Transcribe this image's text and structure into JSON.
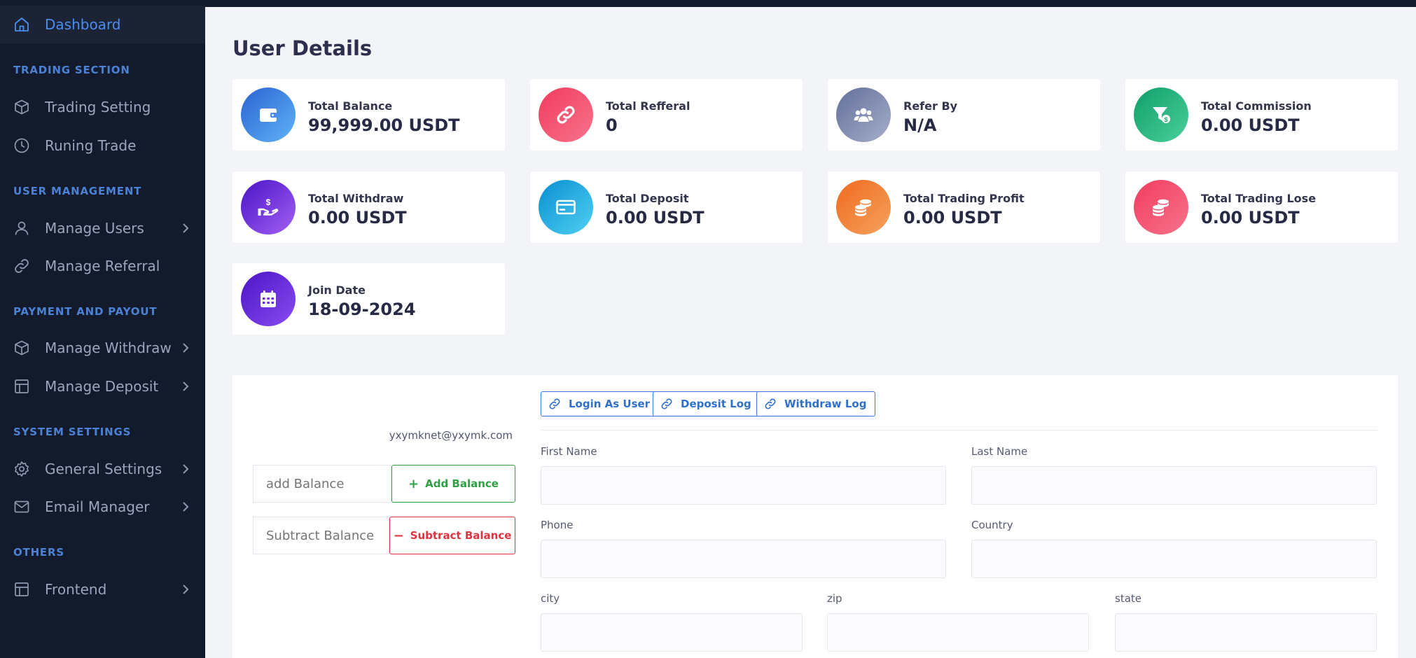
{
  "sidebar": {
    "active": "Dashboard",
    "sections": {
      "trading": "TRADING SECTION",
      "users": "USER MANAGEMENT",
      "payment": "PAYMENT AND PAYOUT",
      "system": "SYSTEM SETTINGS",
      "others": "OTHERS"
    },
    "items": {
      "dashboard": "Dashboard",
      "trading_setting": "Trading Setting",
      "running_trade": "Runing Trade",
      "manage_users": "Manage Users",
      "manage_referral": "Manage Referral",
      "manage_withdraw": "Manage Withdraw",
      "manage_deposit": "Manage Deposit",
      "general_settings": "General Settings",
      "email_manager": "Email Manager",
      "frontend": "Frontend"
    }
  },
  "page": {
    "title": "User Details"
  },
  "stats": {
    "total_balance": {
      "label": "Total Balance",
      "value": "99,999.00 USDT"
    },
    "total_referral": {
      "label": "Total Refferal",
      "value": "0"
    },
    "refer_by": {
      "label": "Refer By",
      "value": "N/A"
    },
    "total_commission": {
      "label": "Total Commission",
      "value": "0.00 USDT"
    },
    "total_withdraw": {
      "label": "Total Withdraw",
      "value": "0.00 USDT"
    },
    "total_deposit": {
      "label": "Total Deposit",
      "value": "0.00 USDT"
    },
    "total_trading_profit": {
      "label": "Total Trading Profit",
      "value": "0.00 USDT"
    },
    "total_trading_lose": {
      "label": "Total Trading Lose",
      "value": "0.00 USDT"
    },
    "join_date": {
      "label": "Join Date",
      "value": "18-09-2024"
    }
  },
  "user": {
    "email": "yxymknet@yxymk.com"
  },
  "balance": {
    "add_placeholder": "add Balance",
    "add_button": "Add Balance",
    "subtract_placeholder": "Subtract Balance",
    "subtract_button": "Subtract Balance"
  },
  "actions": {
    "login_as_user": "Login As User",
    "deposit_log": "Deposit Log",
    "withdraw_log": "Withdraw Log"
  },
  "form": {
    "first_name": "First Name",
    "last_name": "Last Name",
    "phone": "Phone",
    "country": "Country",
    "city": "city",
    "zip": "zip",
    "state": "state"
  },
  "colors": {
    "sidebar_bg": "#121a2b",
    "accent": "#4c8dee",
    "add_green": "#2ea144",
    "subtract_red": "#e1333f",
    "link_blue": "#2f6fce"
  }
}
